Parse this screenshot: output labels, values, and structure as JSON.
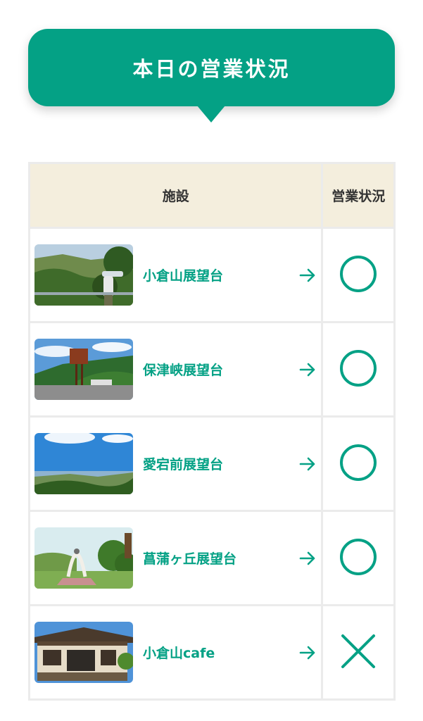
{
  "banner": {
    "title": "本日の営業状況"
  },
  "table": {
    "headers": {
      "facility": "施設",
      "status": "営業状況"
    },
    "rows": [
      {
        "name": "小倉山展望台",
        "status": "open",
        "status_icon": "circle-icon",
        "thumb": "observation-deck-binoculars-photo"
      },
      {
        "name": "保津峡展望台",
        "status": "open",
        "status_icon": "circle-icon",
        "thumb": "signpost-mountain-photo"
      },
      {
        "name": "愛宕前展望台",
        "status": "open",
        "status_icon": "circle-icon",
        "thumb": "sky-valley-view-photo"
      },
      {
        "name": "菖蒲ヶ丘展望台",
        "status": "open",
        "status_icon": "circle-icon",
        "thumb": "bell-monument-photo"
      },
      {
        "name": "小倉山cafe",
        "status": "closed",
        "status_icon": "cross-icon",
        "thumb": "cafe-building-photo"
      }
    ]
  },
  "colors": {
    "accent": "#04a185",
    "header_bg": "#f4eedd",
    "border": "#ebebeb"
  }
}
